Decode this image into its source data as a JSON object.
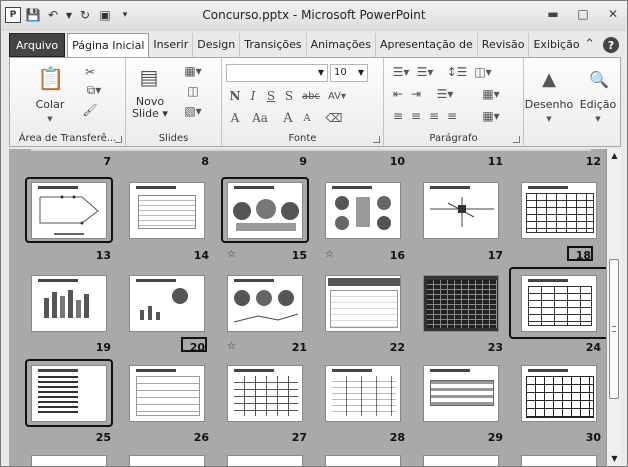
{
  "window": {
    "title": "Concurso.pptx - Microsoft PowerPoint",
    "app_icon": "P"
  },
  "tabs": [
    "Arquivo",
    "Página Inicial",
    "Inserir",
    "Design",
    "Transições",
    "Animações",
    "Apresentação de",
    "Revisão",
    "Exibição"
  ],
  "ribbon": {
    "clipboard": {
      "label": "Área de Transferê...",
      "paste": "Colar"
    },
    "slides": {
      "label": "Slides",
      "new_slide": "Novo\nSlide",
      "new_slide_a": "Novo",
      "new_slide_b": "Slide"
    },
    "font": {
      "label": "Fonte",
      "size": "10",
      "bold": "N",
      "italic": "I",
      "underline": "S",
      "strike": "S",
      "abc": "abc",
      "grow": "A",
      "shrink": "A",
      "aa": "Aa"
    },
    "paragraph": {
      "label": "Parágrafo"
    },
    "drawing": {
      "label": "Desenho"
    },
    "editing": {
      "label": "Edição"
    }
  },
  "slides": {
    "top_row_numbers": [
      "7",
      "8",
      "9",
      "10",
      "11",
      "12"
    ],
    "rows": [
      {
        "numbers": [
          "13",
          "14",
          "15",
          "16",
          "17",
          "18"
        ]
      },
      {
        "numbers": [
          "19",
          "20",
          "21",
          "22",
          "23",
          "24"
        ]
      },
      {
        "numbers": [
          "25",
          "26",
          "27",
          "28",
          "29",
          "30"
        ]
      }
    ],
    "selected": [
      "13",
      "15",
      "24",
      "25"
    ],
    "hidden": [
      "18",
      "20"
    ],
    "animated": [
      "15",
      "16",
      "21"
    ]
  },
  "colors": {
    "sorter_bg": "#a9a9a9",
    "file_tab": "#444444"
  }
}
